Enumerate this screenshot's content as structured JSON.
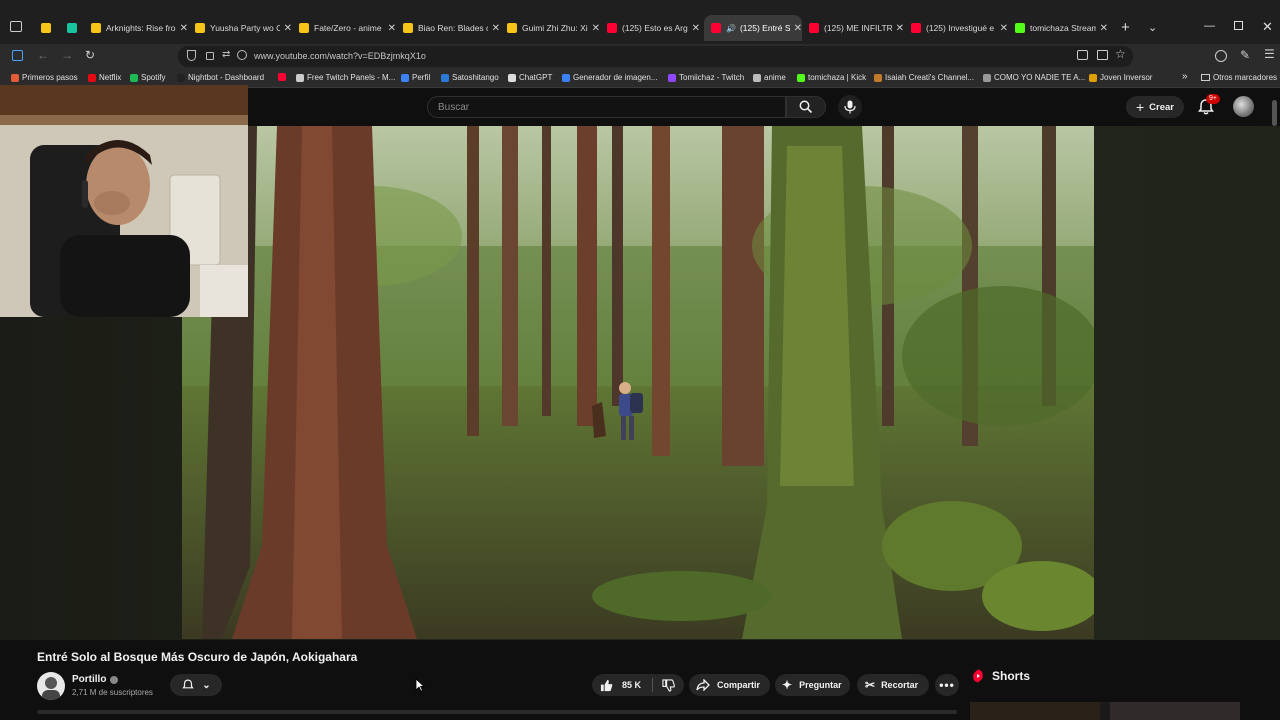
{
  "browser": {
    "tabs": [
      {
        "label": "",
        "favicon_color": "#f5c518"
      },
      {
        "label": "",
        "favicon_color": "#19c3a0"
      },
      {
        "label": "Arknights: Rise fro",
        "favicon_color": "#f5c518"
      },
      {
        "label": "Yuusha Party wo C",
        "favicon_color": "#f5c518"
      },
      {
        "label": "Fate/Zero - anime",
        "favicon_color": "#f5c518"
      },
      {
        "label": "Biao Ren: Blades o",
        "favicon_color": "#f5c518"
      },
      {
        "label": "Guimi Zhi Zhu: Xi",
        "favicon_color": "#f5c518"
      },
      {
        "label": "(125) Esto es Arge",
        "favicon_color": "#ff0033"
      },
      {
        "label": "(125) Entré So",
        "favicon_color": "#ff0033"
      },
      {
        "label": "(125) ME INFILTR",
        "favicon_color": "#ff0033"
      },
      {
        "label": "(125) Investigué e",
        "favicon_color": "#ff0033"
      },
      {
        "label": "tomichaza Stream",
        "favicon_color": "#53fc18"
      }
    ],
    "new_tab": "+",
    "url": "www.youtube.com/watch?v=EDBzjmkqX1o",
    "bookmarks": [
      {
        "label": "Primeros pasos",
        "color": "#e25c3a"
      },
      {
        "label": "Netflix",
        "color": "#e50914"
      },
      {
        "label": "Spotify",
        "color": "#1db954"
      },
      {
        "label": "Nightbot - Dashboard",
        "color": "#222222"
      },
      {
        "label": "",
        "color": "#ff0033"
      },
      {
        "label": "Free Twitch Panels - M...",
        "color": "#cccccc"
      },
      {
        "label": "Perfil",
        "color": "#3b82f6"
      },
      {
        "label": "Satoshitango",
        "color": "#2b7bd6"
      },
      {
        "label": "ChatGPT",
        "color": "#dddddd"
      },
      {
        "label": "Generador de imagen...",
        "color": "#3b82f6"
      },
      {
        "label": "Tomiichaz - Twitch",
        "color": "#9146ff"
      },
      {
        "label": "anime",
        "color": "#bbbbbb"
      },
      {
        "label": "tomichaza | Kick",
        "color": "#53fc18"
      },
      {
        "label": "Isaiah Creati's Channel...",
        "color": "#c07a2a"
      },
      {
        "label": "COMO YO NADIE TE A...",
        "color": "#999999"
      },
      {
        "label": "Joven Inversor",
        "color": "#e0a000"
      }
    ],
    "other_bookmarks": "Otros marcadores"
  },
  "youtube": {
    "search_placeholder": "Buscar",
    "create_label": "Crear",
    "notifications_badge": "9+",
    "video_title": "Entré Solo al Bosque Más Oscuro de Japón, Aokigahara",
    "channel_name": "Portillo",
    "subscribers": "2,71 M de suscriptores",
    "likes": "85 K",
    "share_label": "Compartir",
    "ask_label": "Preguntar",
    "clip_label": "Recortar",
    "shorts_label": "Shorts"
  },
  "colors": {
    "accent_red": "#ff0033",
    "badge_red": "#cc0000"
  }
}
